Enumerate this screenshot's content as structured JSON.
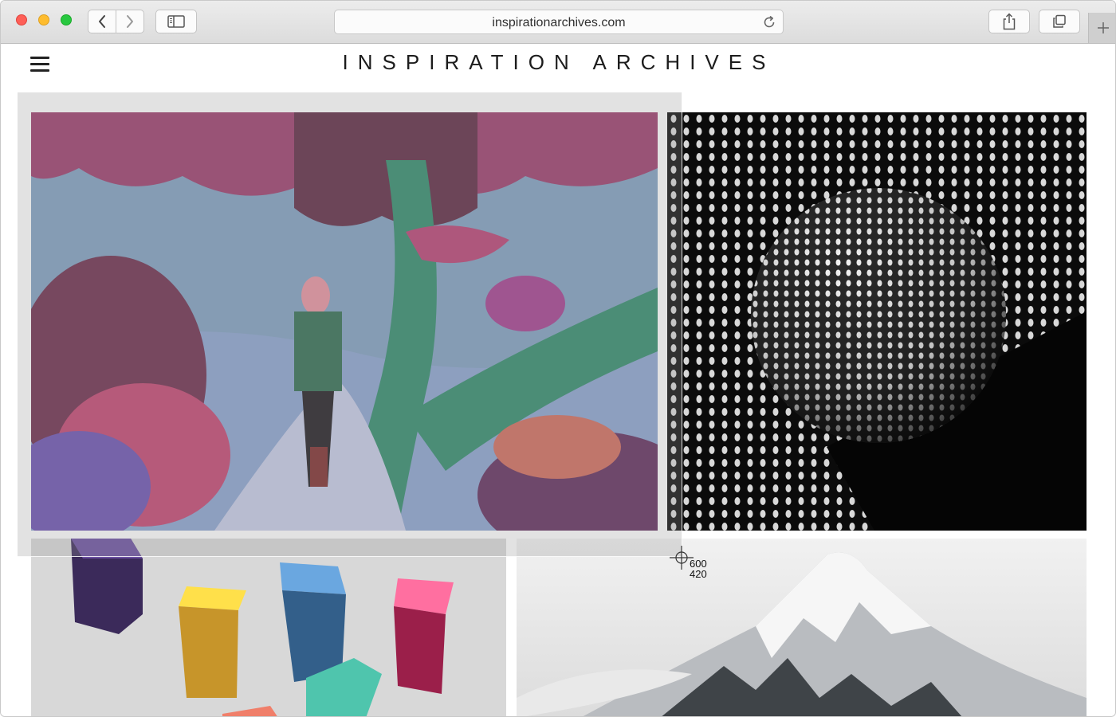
{
  "browser": {
    "url": "inspirationarchives.com",
    "icons": {
      "back": "chevron-left-icon",
      "forward": "chevron-right-icon",
      "sidebar": "sidebar-icon",
      "reload": "reload-icon",
      "share": "share-icon",
      "tabs": "tabs-overview-icon",
      "new_tab": "plus-icon"
    }
  },
  "page": {
    "menu_icon": "hamburger-menu-icon",
    "title": "INSPIRATION ARCHIVES",
    "gallery": [
      {
        "name": "forest-illustration",
        "kind": "illustration"
      },
      {
        "name": "halftone-sphere",
        "kind": "photo"
      },
      {
        "name": "colored-cubes",
        "kind": "render"
      },
      {
        "name": "snowy-mountain",
        "kind": "photo"
      }
    ]
  },
  "screenshot_selection": {
    "width_readout": "600",
    "height_readout": "420"
  },
  "colors": {
    "traffic_red": "#fe5f57",
    "traffic_yellow": "#febc2e",
    "traffic_green": "#28c840",
    "title_text": "#1c1c1c"
  }
}
